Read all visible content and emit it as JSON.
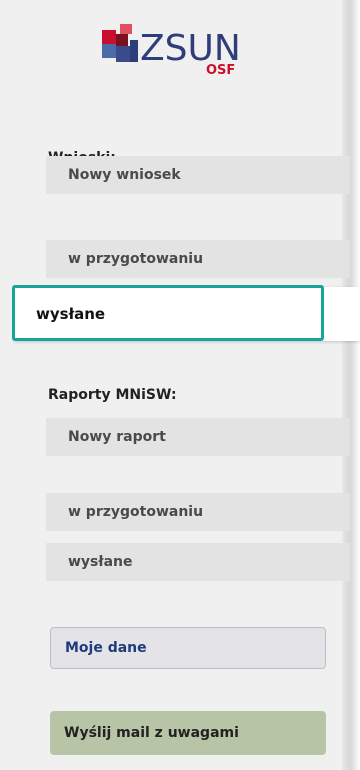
{
  "logo": {
    "text": "ZSUN",
    "subtext": "OSF"
  },
  "wnioski": {
    "heading": "Wnioski:",
    "new_label": "Nowy wniosek",
    "draft_label": "w przygotowaniu",
    "sent_label": "wysłane"
  },
  "raporty": {
    "heading": "Raporty MNiSW:",
    "new_label": "Nowy raport",
    "draft_label": "w przygotowaniu",
    "sent_label": "wysłane"
  },
  "buttons": {
    "moje_dane": "Moje dane",
    "mail": "Wyślij mail z uwagami"
  },
  "colors": {
    "accent_focus": "#1aa39b",
    "logo_red": "#c8102e",
    "logo_blue": "#3b4a8c",
    "mail_button": "#b8c4a6",
    "link_blue": "#1f3c7a"
  }
}
